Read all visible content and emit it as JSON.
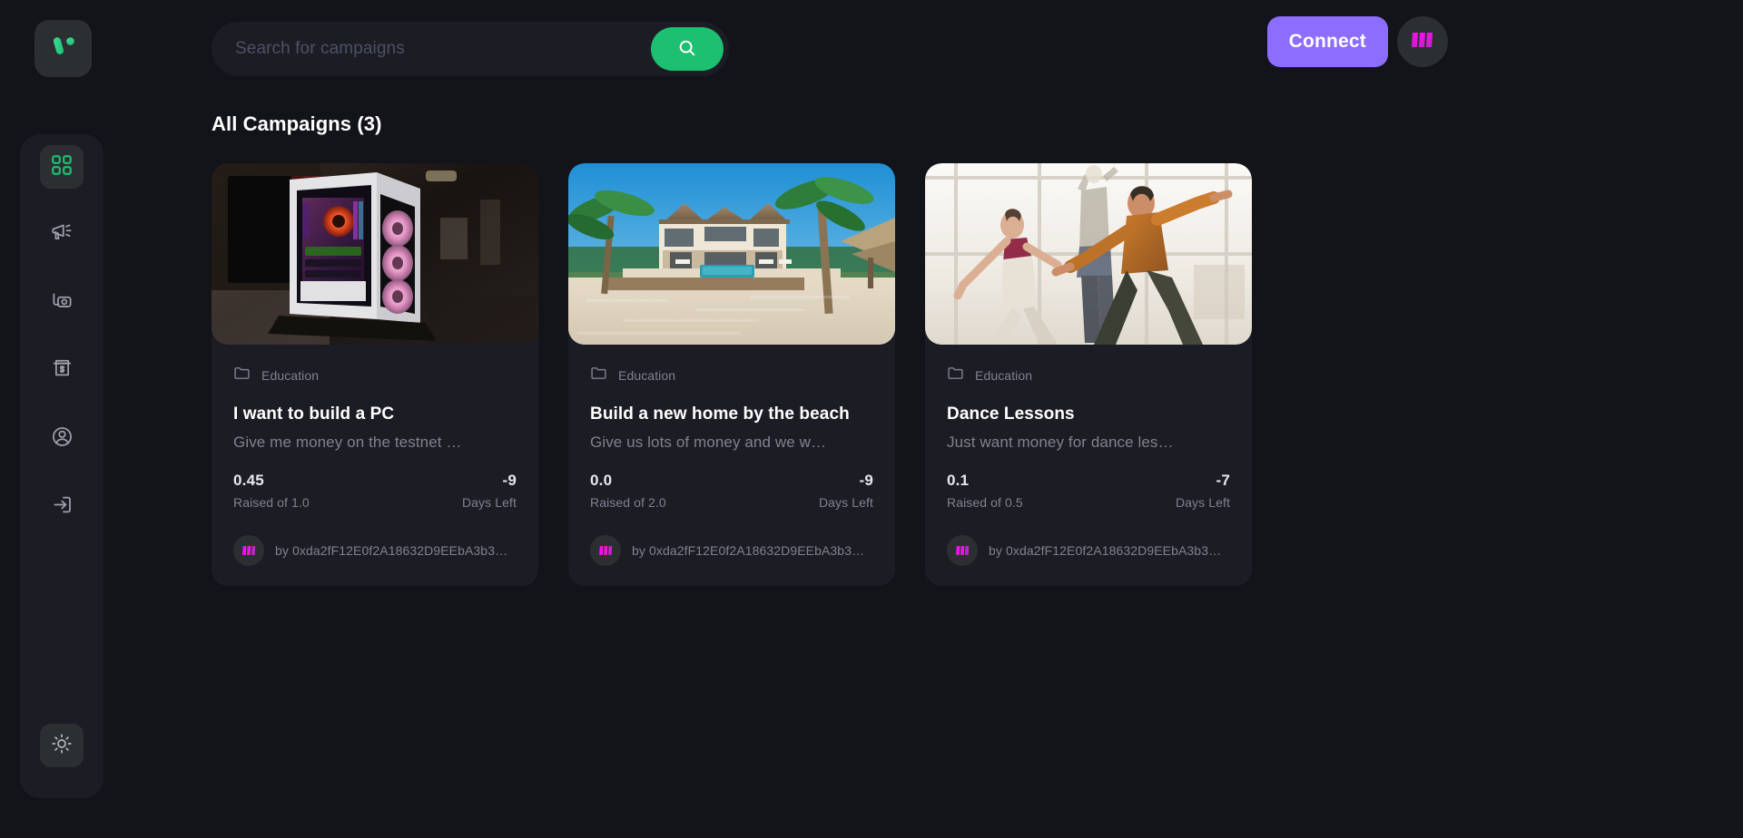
{
  "theme": {
    "page_bg": "#13131a",
    "panel_bg": "#1c1c24",
    "accent_green": "#1dc071",
    "accent_purple": "#8c6dfd",
    "muted_text": "#808191",
    "avatar_pink": "#ff0bf5"
  },
  "topbar": {
    "brand_icon": "v-logo-icon",
    "search": {
      "placeholder": "Search for campaigns",
      "value": "",
      "button_icon": "search-icon"
    },
    "connect_label": "Connect",
    "avatar_icon": "wallet-avatar-icon"
  },
  "sidebar": {
    "items": [
      {
        "name": "dashboard",
        "icon": "dashboard-grid-icon",
        "active": true
      },
      {
        "name": "campaign",
        "icon": "megaphone-icon",
        "active": false
      },
      {
        "name": "payment",
        "icon": "money-card-icon",
        "active": false
      },
      {
        "name": "withdraw",
        "icon": "withdraw-dollar-icon",
        "active": false
      },
      {
        "name": "profile",
        "icon": "user-circle-icon",
        "active": false
      },
      {
        "name": "logout",
        "icon": "logout-arrow-icon",
        "active": false
      }
    ],
    "theme_toggle": {
      "name": "theme-toggle",
      "icon": "sun-icon"
    }
  },
  "main": {
    "page_title": "All Campaigns (3)",
    "campaign_count": 3,
    "cards": [
      {
        "image": "gaming-pc-rgb",
        "category_icon": "folder-icon",
        "category": "Education",
        "title": "I want to build a PC",
        "description": "Give me money on the testnet …",
        "raised_value": "0.45",
        "raised_label": "Raised of 1.0",
        "days_value": "-9",
        "days_label": "Days Left",
        "owner_prefix": "by",
        "owner_address": "0xda2fF12E0f2A18632D9EEbA3b3…"
      },
      {
        "image": "beach-villa",
        "category_icon": "folder-icon",
        "category": "Education",
        "title": "Build a new home by the beach",
        "description": "Give us lots of money and we w…",
        "raised_value": "0.0",
        "raised_label": "Raised of 2.0",
        "days_value": "-9",
        "days_label": "Days Left",
        "owner_prefix": "by",
        "owner_address": "0xda2fF12E0f2A18632D9EEbA3b3…"
      },
      {
        "image": "dancers-studio",
        "category_icon": "folder-icon",
        "category": "Education",
        "title": "Dance Lessons",
        "description": "Just want money for dance les…",
        "raised_value": "0.1",
        "raised_label": "Raised of 0.5",
        "days_value": "-7",
        "days_label": "Days Left",
        "owner_prefix": "by",
        "owner_address": "0xda2fF12E0f2A18632D9EEbA3b3…"
      }
    ]
  }
}
